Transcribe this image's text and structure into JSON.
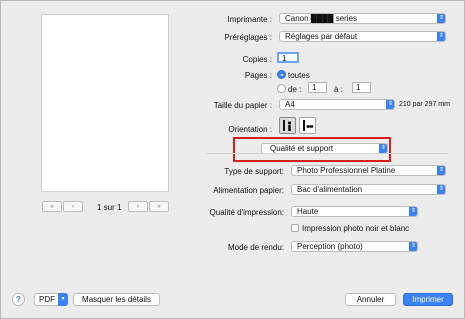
{
  "preview": {
    "page_indicator": "1 sur 1"
  },
  "printer": {
    "label": "Imprimante :",
    "value": "Canon ████ series"
  },
  "presets": {
    "label": "Préréglages :",
    "value": "Réglages par défaut"
  },
  "copies": {
    "label": "Copies :",
    "value": "1"
  },
  "pages": {
    "label": "Pages :",
    "all_label": "toutes",
    "from_label": "de :",
    "from_value": "1",
    "to_label": "à :",
    "to_value": "1"
  },
  "paper_size": {
    "label": "Taille du papier :",
    "value": "A4",
    "dimensions": "210 par 297 mm"
  },
  "orientation": {
    "label": "Orientation :"
  },
  "panel_menu": {
    "value": "Qualité et support"
  },
  "media_type": {
    "label": "Type de support:",
    "value": "Photo Professionnel Platine"
  },
  "paper_source": {
    "label": "Alimentation papier:",
    "value": "Bac d'alimentation"
  },
  "print_quality": {
    "label": "Qualité d'impression:",
    "value": "Haute"
  },
  "grayscale": {
    "label": "Impression photo noir et blanc"
  },
  "rendering": {
    "label": "Mode de rendu:",
    "value": "Perception (photo)"
  },
  "footer": {
    "help": "?",
    "pdf": "PDF",
    "hide_details": "Masquer les détails",
    "cancel": "Annuler",
    "print": "Imprimer"
  },
  "colors": {
    "accent": "#3b82f6",
    "highlight_box": "#d81e1e"
  }
}
